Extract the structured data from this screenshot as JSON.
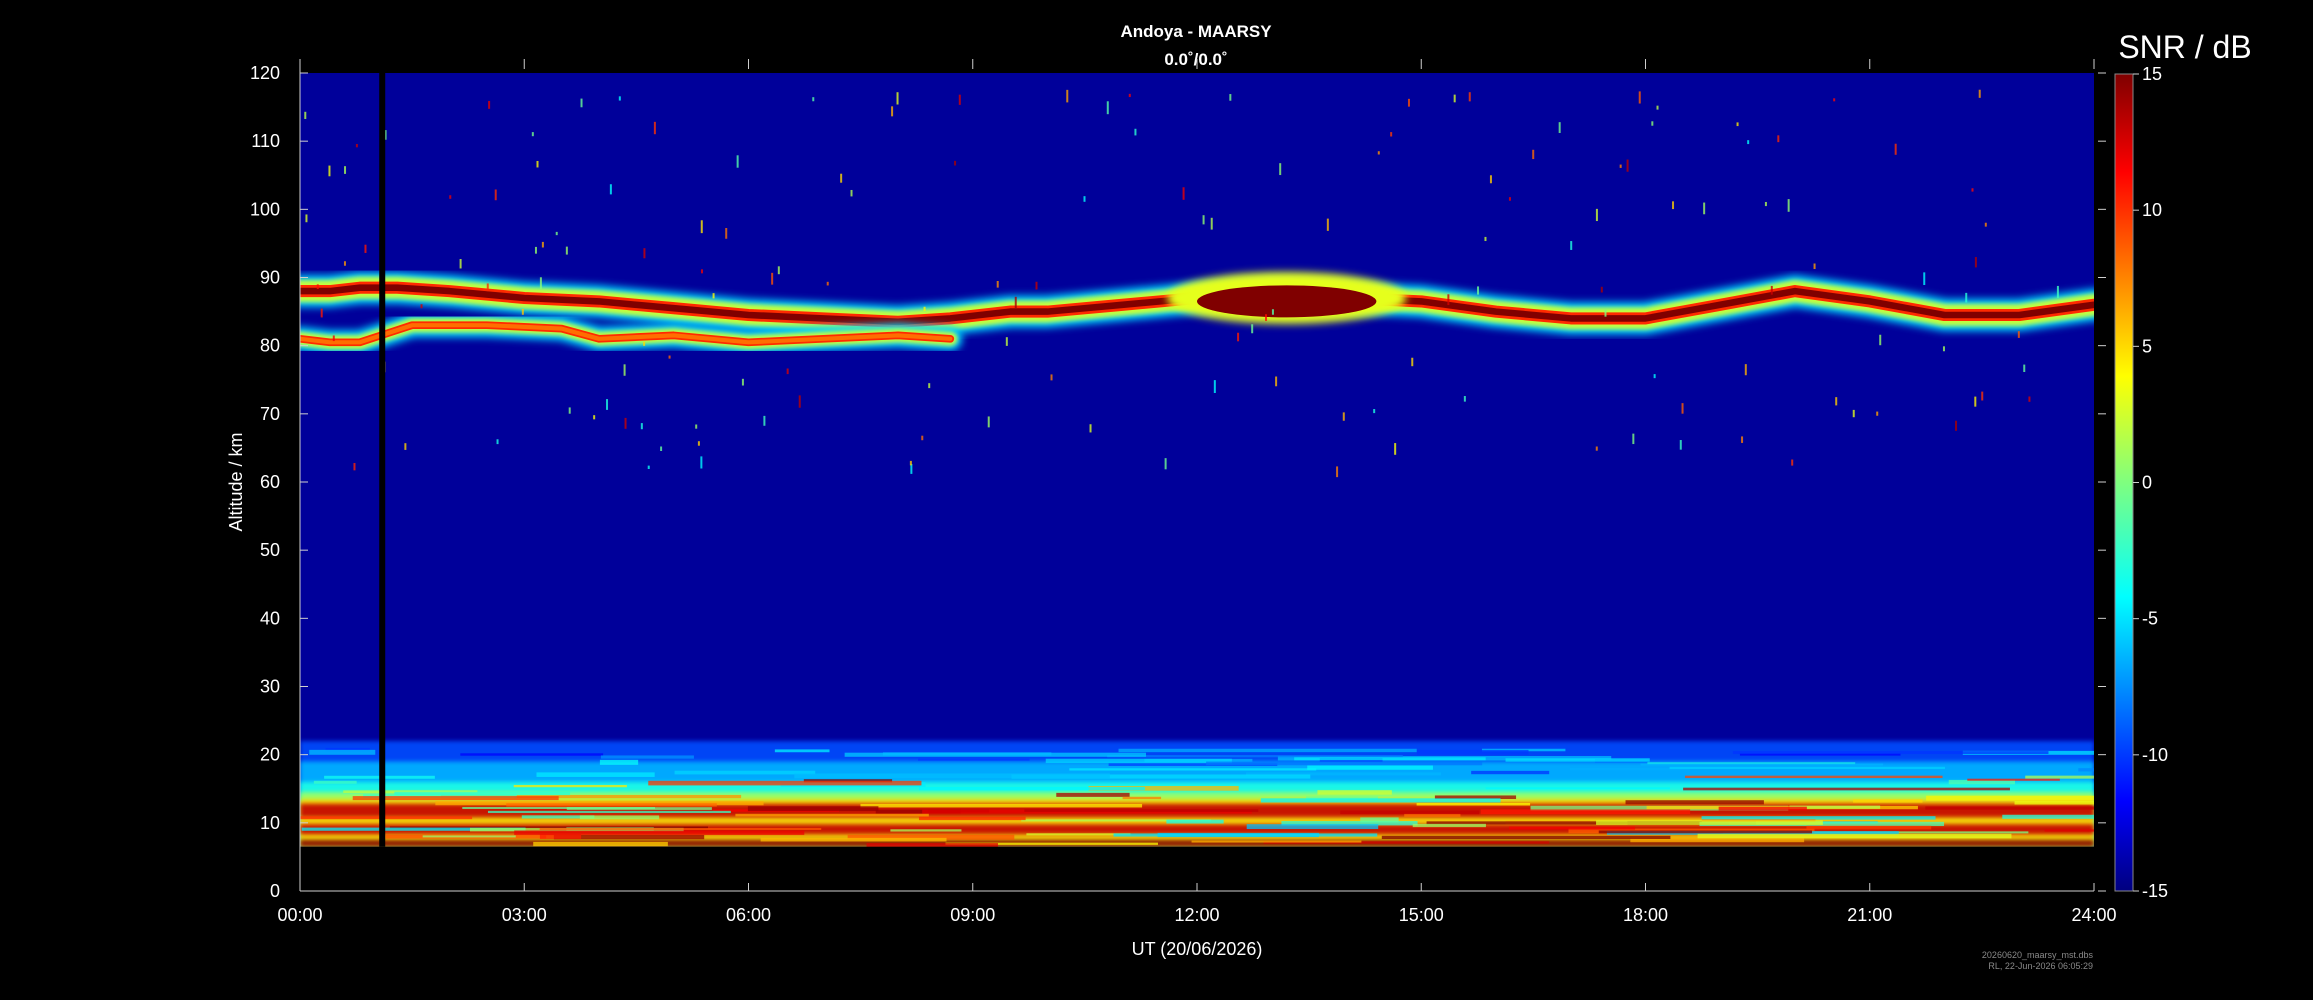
{
  "chart_data": {
    "type": "heatmap",
    "title": "Andoya - MAARSY",
    "subtitle": "0.0˚/0.0˚",
    "xlabel": "UT (20/06/2026)",
    "ylabel": "Altitude / km",
    "x_ticks": [
      "00:00",
      "03:00",
      "06:00",
      "09:00",
      "12:00",
      "15:00",
      "18:00",
      "21:00",
      "24:00"
    ],
    "xlim_hours": [
      0,
      24
    ],
    "y_ticks": [
      0,
      10,
      20,
      30,
      40,
      50,
      60,
      70,
      80,
      90,
      100,
      110,
      120
    ],
    "ylim": [
      0,
      120
    ],
    "colorbar": {
      "label": "SNR / dB",
      "range": [
        -15,
        15
      ],
      "ticks": [
        15,
        10,
        5,
        0,
        -5,
        -10,
        -15
      ],
      "colormap": "jet"
    },
    "data_gap_hour": 1.1,
    "data_floor_km": 6.5,
    "background_color": "#000000",
    "footer": [
      "20260620_maarsy_mst.dbs",
      "RL, 22-Jun-2026 06:05:29"
    ],
    "echo_layers": [
      {
        "name": "PMSE upper",
        "hours": [
          0,
          0.4,
          0.8,
          1.3,
          2,
          3,
          4,
          5,
          6,
          7,
          8,
          8.7,
          9.5,
          10,
          11,
          12,
          13,
          14,
          15,
          16,
          17,
          18,
          19,
          20,
          21,
          22,
          23,
          24
        ],
        "alt_km": [
          88,
          88,
          88.5,
          88.5,
          88,
          87,
          86.5,
          85.5,
          84.5,
          84,
          83.5,
          84,
          85,
          85,
          86,
          87,
          87.5,
          87,
          86.5,
          85,
          84,
          84,
          86,
          88,
          86.5,
          84.5,
          84.5,
          86
        ],
        "peak_snr_db": 15
      },
      {
        "name": "PMSE lower",
        "hours": [
          0,
          0.4,
          0.8,
          1.5,
          2.5,
          3.5,
          4,
          5,
          6,
          7,
          8,
          8.7
        ],
        "alt_km": [
          81,
          80.5,
          80.5,
          83,
          83,
          82.5,
          81,
          81.5,
          80.5,
          81,
          81.5,
          81
        ],
        "peak_snr_db": 8
      },
      {
        "name": "Troposphere 11 km",
        "hours": [
          0,
          24
        ],
        "alt_km": [
          11.5,
          11.5
        ],
        "peak_snr_db": 15
      },
      {
        "name": "Troposphere 9 km",
        "hours": [
          0,
          24
        ],
        "alt_km": [
          9,
          9
        ],
        "peak_snr_db": 15
      },
      {
        "name": "Lower stratosphere",
        "hours": [
          0,
          24
        ],
        "alt_km": [
          17,
          17
        ],
        "peak_snr_db": 0
      }
    ]
  }
}
